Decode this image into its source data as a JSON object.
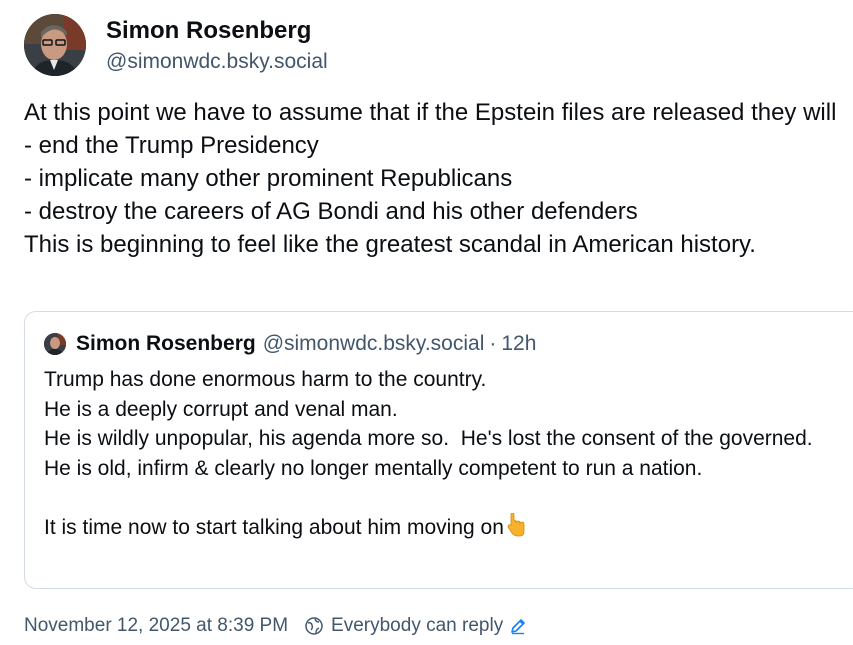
{
  "post": {
    "author": {
      "display_name": "Simon Rosenberg",
      "handle": "@simonwdc.bsky.social",
      "avatar_icon": "profile-photo"
    },
    "text": "At this point we have to assume that if the Epstein files are released they will\n- end the Trump Presidency\n- implicate many other prominent Republicans\n- destroy the careers of AG Bondi and his other defenders\nThis is beginning to feel like the greatest scandal in American history.",
    "quote": {
      "display_name": "Simon Rosenberg",
      "handle": "@simonwdc.bsky.social",
      "separator": "·",
      "time": "12h",
      "text": "Trump has done enormous harm to the country.\nHe is a deeply corrupt and venal man.\nHe is wildly unpopular, his agenda more so.  He's lost the consent of the governed.\nHe is old, infirm & clearly no longer mentally competent to run a nation.\n\nIt is time now to start talking about him moving on",
      "emoji": "👇"
    },
    "footer": {
      "timestamp": "November 12, 2025 at 8:39 PM",
      "reply_setting": "Everybody can reply",
      "reply_icon": "globe-icon",
      "edit_icon": "pencil-icon"
    }
  },
  "colors": {
    "text_primary": "#0b0f14",
    "text_secondary": "#42576c",
    "border": "#d4dbe2",
    "accent": "#1083fe",
    "emoji_yellow": "#f7b12b"
  }
}
